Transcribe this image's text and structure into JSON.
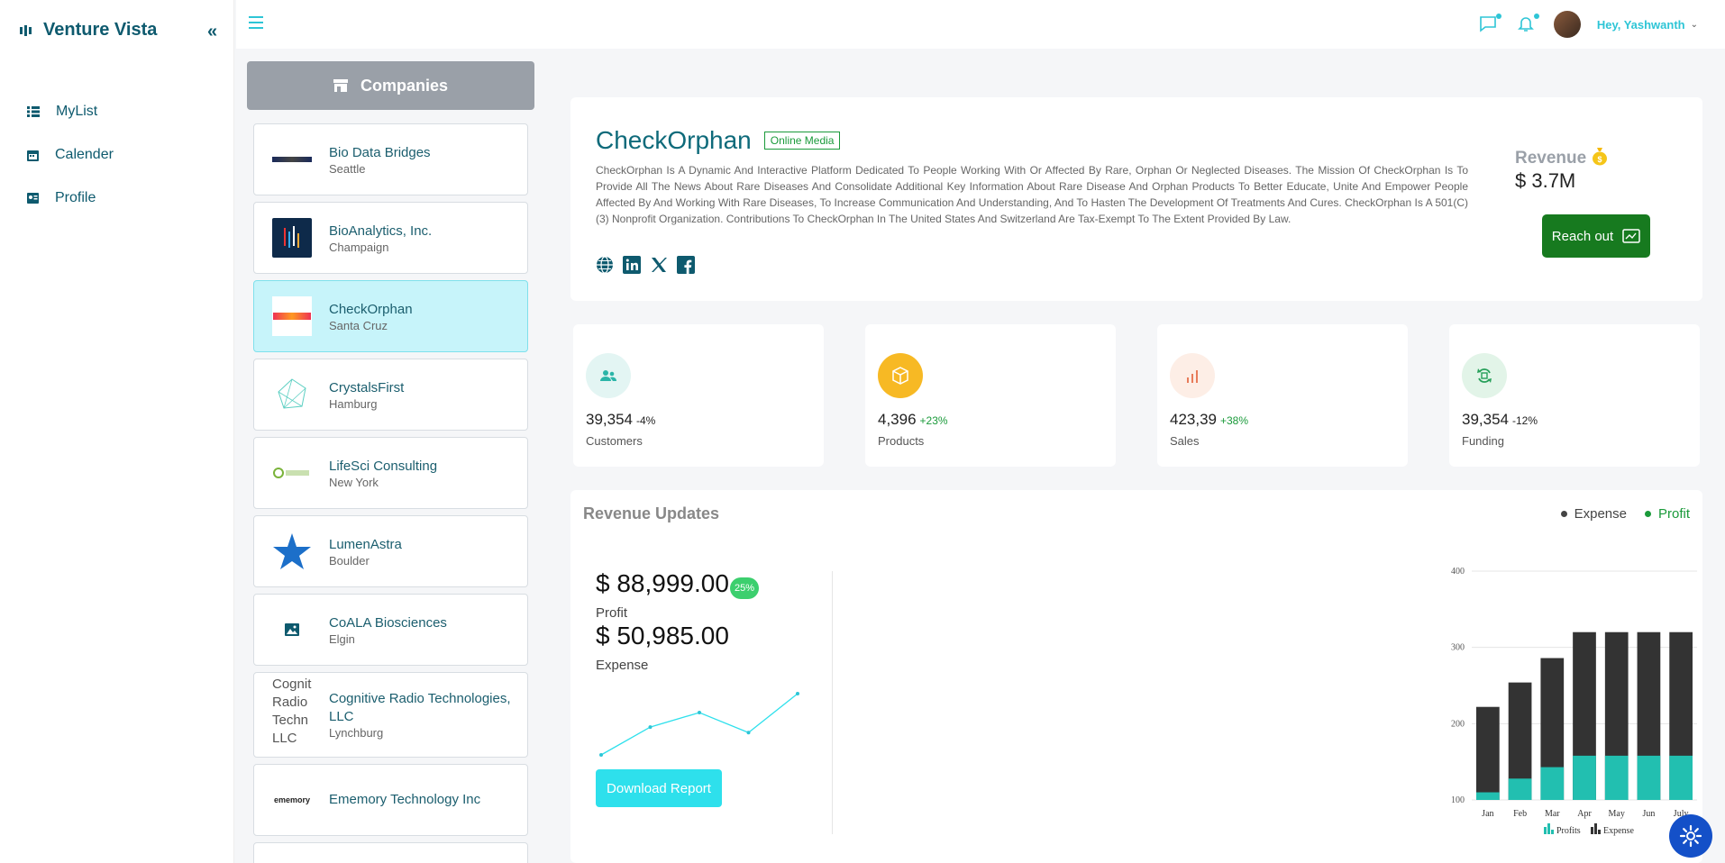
{
  "brand": {
    "name": "Venture Vista"
  },
  "nav": [
    {
      "label": "MyList",
      "icon": "list-icon"
    },
    {
      "label": "Calender",
      "icon": "calendar-icon"
    },
    {
      "label": "Profile",
      "icon": "profile-icon"
    }
  ],
  "topbar": {
    "greeting": "Hey, Yashwanth"
  },
  "companies": {
    "header": "Companies",
    "items": [
      {
        "name": "Bio Data Bridges",
        "city": "Seattle"
      },
      {
        "name": "BioAnalytics, Inc.",
        "city": "Champaign"
      },
      {
        "name": "CheckOrphan",
        "city": "Santa Cruz",
        "active": true
      },
      {
        "name": "CrystalsFirst",
        "city": "Hamburg"
      },
      {
        "name": "LifeSci Consulting",
        "city": "New York"
      },
      {
        "name": "LumenAstra",
        "city": "Boulder"
      },
      {
        "name": "CoALA Biosciences",
        "city": "Elgin"
      },
      {
        "name": "Cognitive Radio Technologies, LLC",
        "city": "Lynchburg",
        "logo_alt": "Cognit Radio Techn LLC"
      },
      {
        "name": "Ememory Technology Inc",
        "city": "",
        "logo_text": "ememоry"
      }
    ]
  },
  "profile": {
    "name": "CheckOrphan",
    "tag": "Online Media",
    "description": "CheckOrphan Is A Dynamic And Interactive Platform Dedicated To People Working With Or Affected By Rare, Orphan Or Neglected Diseases. The Mission Of CheckOrphan Is To Provide All The News About Rare Diseases And Consolidate Additional Key Information About Rare Disease And Orphan Products To Better Educate, Unite And Empower People Affected By And Working With Rare Diseases, To Increase Communication And Understanding, And To Hasten The Development Of Treatments And Cures. CheckOrphan Is A 501(C)(3) Nonprofit Organization. Contributions To CheckOrphan In The United States And Switzerland Are Tax-Exempt To The Extent Provided By Law.",
    "revenue_label": "Revenue",
    "revenue_value": "$ 3.7M",
    "reach_label": "Reach out"
  },
  "stats": [
    {
      "value": "39,354",
      "change": "-4%",
      "label": "Customers",
      "color": "#2bb5a8",
      "bg": "#e3f5f3"
    },
    {
      "value": "4,396",
      "change": "+23%",
      "label": "Products",
      "color": "#ffffff",
      "bg": "#f7b924"
    },
    {
      "value": "423,39",
      "change": "+38%",
      "label": "Sales",
      "color": "#e87c5a",
      "bg": "#fdeee6"
    },
    {
      "value": "39,354",
      "change": "-12%",
      "label": "Funding",
      "color": "#27a05a",
      "bg": "#e2f4e8"
    }
  ],
  "revenue_updates": {
    "title": "Revenue Updates",
    "legend": [
      "Expense",
      "Profit"
    ],
    "profit_value": "$ 88,999.00",
    "profit_badge": "25%",
    "profit_label": "Profit",
    "expense_value": "$ 50,985.00",
    "expense_label": "Expense",
    "download_label": "Download Report",
    "sparkline": [
      10,
      35,
      48,
      30,
      65
    ]
  },
  "chart_data": {
    "type": "bar",
    "categories": [
      "Jan",
      "Feb",
      "Mar",
      "Apr",
      "May",
      "Jun",
      "July"
    ],
    "series": [
      {
        "name": "Profits",
        "values": [
          110,
          128,
          143,
          158,
          158,
          158,
          158
        ],
        "color": "#22bfb0"
      },
      {
        "name": "Expense",
        "values": [
          222,
          254,
          286,
          320,
          320,
          320,
          320
        ],
        "color": "#333333"
      }
    ],
    "yticks": [
      100,
      200,
      300,
      400
    ],
    "ylim": [
      100,
      400
    ],
    "legend": [
      "Profits",
      "Expense"
    ]
  },
  "colors": {
    "accent": "#2ec5d6",
    "brand": "#0e5a6e",
    "reach": "#177a1f"
  }
}
